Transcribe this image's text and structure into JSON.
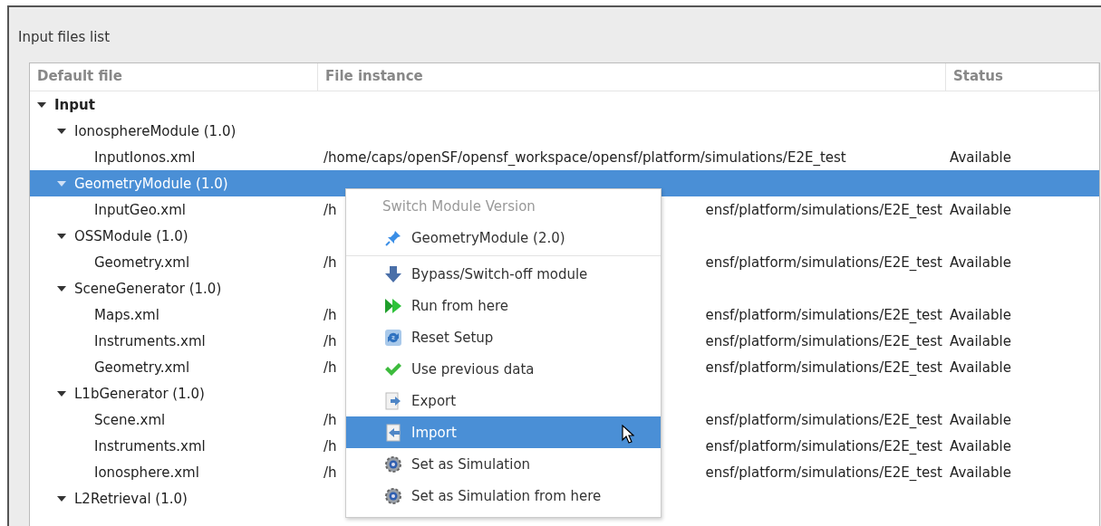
{
  "panel": {
    "title": "Input files list"
  },
  "table": {
    "columns": [
      "Default file",
      "File instance",
      "Status"
    ],
    "tree": [
      {
        "label": "Input",
        "expanded": true,
        "selected": false,
        "children": [
          {
            "label": "IonosphereModule (1.0)",
            "expanded": true,
            "selected": false,
            "children": [
              {
                "label": "InputIonos.xml",
                "selected": false,
                "instance": "/home/caps/openSF/opensf_workspace/opensf/platform/simulations/E2E_test",
                "status": "Available"
              }
            ]
          },
          {
            "label": "GeometryModule (1.0)",
            "expanded": true,
            "selected": true,
            "children": [
              {
                "label": "InputGeo.xml",
                "selected": false,
                "instance_parts": [
                  "/h",
                  "ensf/platform/simulations/E2E_test"
                ],
                "status": "Available"
              }
            ]
          },
          {
            "label": "OSSModule (1.0)",
            "expanded": true,
            "selected": false,
            "children": [
              {
                "label": "Geometry.xml",
                "selected": false,
                "instance_parts": [
                  "/h",
                  "ensf/platform/simulations/E2E_test"
                ],
                "status": "Available"
              }
            ]
          },
          {
            "label": "SceneGenerator (1.0)",
            "expanded": true,
            "selected": false,
            "children": [
              {
                "label": "Maps.xml",
                "selected": false,
                "instance_parts": [
                  "/h",
                  "ensf/platform/simulations/E2E_test"
                ],
                "status": "Available"
              },
              {
                "label": "Instruments.xml",
                "selected": false,
                "instance_parts": [
                  "/h",
                  "ensf/platform/simulations/E2E_test"
                ],
                "status": "Available"
              },
              {
                "label": "Geometry.xml",
                "selected": false,
                "instance_parts": [
                  "/h",
                  "ensf/platform/simulations/E2E_test"
                ],
                "status": "Available"
              }
            ]
          },
          {
            "label": "L1bGenerator (1.0)",
            "expanded": true,
            "selected": false,
            "children": [
              {
                "label": "Scene.xml",
                "selected": false,
                "instance_parts": [
                  "/h",
                  "ensf/platform/simulations/E2E_test"
                ],
                "status": "Available"
              },
              {
                "label": "Instruments.xml",
                "selected": false,
                "instance_parts": [
                  "/h",
                  "ensf/platform/simulations/E2E_test"
                ],
                "status": "Available"
              },
              {
                "label": "Ionosphere.xml",
                "selected": false,
                "instance_parts": [
                  "/h",
                  "ensf/platform/simulations/E2E_test"
                ],
                "status": "Available"
              }
            ]
          },
          {
            "label": "L2Retrieval (1.0)",
            "expanded": true,
            "selected": false
          }
        ]
      }
    ]
  },
  "context_menu": {
    "title": "Switch Module Version",
    "sections": [
      [
        {
          "kind": "pin",
          "label": "GeometryModule (2.0)",
          "selected": false
        }
      ],
      [
        {
          "kind": "bypass",
          "label": "Bypass/Switch-off module",
          "selected": false
        },
        {
          "kind": "run",
          "label": "Run from here",
          "selected": false
        },
        {
          "kind": "reset",
          "label": "Reset Setup",
          "selected": false
        },
        {
          "kind": "check",
          "label": "Use previous data",
          "selected": false
        },
        {
          "kind": "export",
          "label": "Export",
          "selected": false
        },
        {
          "kind": "import",
          "label": "Import",
          "selected": true
        },
        {
          "kind": "gear",
          "label": "Set as Simulation",
          "selected": false
        },
        {
          "kind": "gear",
          "label": "Set as Simulation from here",
          "selected": false
        }
      ]
    ]
  }
}
